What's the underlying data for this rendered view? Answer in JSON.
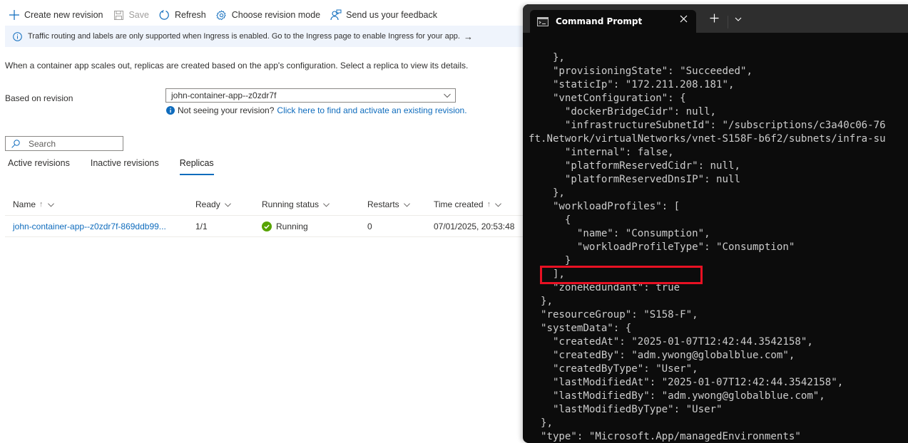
{
  "toolbar": {
    "create": {
      "label": "Create new revision",
      "icon": "plus-icon"
    },
    "save": {
      "label": "Save",
      "icon": "save-icon",
      "disabled": true
    },
    "refresh": {
      "label": "Refresh",
      "icon": "refresh-icon"
    },
    "mode": {
      "label": "Choose revision mode",
      "icon": "gear-icon"
    },
    "feedback": {
      "label": "Send us your feedback",
      "icon": "feedback-icon"
    }
  },
  "info_banner": {
    "text": "Traffic routing and labels are only supported when Ingress is enabled. Go to the Ingress page to enable Ingress for your app.",
    "arrow": "→"
  },
  "description": "When a container app scales out, replicas are created based on the app's configuration. Select a replica to view its details.",
  "revision": {
    "label": "Based on revision",
    "selected": "john-container-app--z0zdr7f",
    "hint_text": "Not seeing your revision?",
    "hint_link": "Click here to find and activate an existing revision."
  },
  "search": {
    "placeholder": "Search"
  },
  "tabs": [
    {
      "label": "Active revisions",
      "active": false
    },
    {
      "label": "Inactive revisions",
      "active": false
    },
    {
      "label": "Replicas",
      "active": true
    }
  ],
  "table": {
    "columns": [
      {
        "label": "Name",
        "sort": "↑"
      },
      {
        "label": "Ready",
        "sort": ""
      },
      {
        "label": "Running status",
        "sort": ""
      },
      {
        "label": "Restarts",
        "sort": ""
      },
      {
        "label": "Time created",
        "sort": "↑"
      }
    ],
    "rows": [
      {
        "name": "john-container-app--z0zdr7f-869ddb99...",
        "ready": "1/1",
        "status": "Running",
        "restarts": "0",
        "time_created": "07/01/2025, 20:53:48"
      }
    ]
  },
  "terminal": {
    "tab_title": "Command Prompt",
    "lines": [
      "    },",
      "    \"provisioningState\": \"Succeeded\",",
      "    \"staticIp\": \"172.211.208.181\",",
      "    \"vnetConfiguration\": {",
      "      \"dockerBridgeCidr\": null,",
      "      \"infrastructureSubnetId\": \"/subscriptions/c3a40c06-76",
      "ft.Network/virtualNetworks/vnet-S158F-b6f2/subnets/infra-su",
      "      \"internal\": false,",
      "      \"platformReservedCidr\": null,",
      "      \"platformReservedDnsIP\": null",
      "    },",
      "    \"workloadProfiles\": [",
      "      {",
      "        \"name\": \"Consumption\",",
      "        \"workloadProfileType\": \"Consumption\"",
      "      }",
      "    ],",
      "    \"zoneRedundant\": true",
      "  },",
      "  \"resourceGroup\": \"S158-F\",",
      "  \"systemData\": {",
      "    \"createdAt\": \"2025-01-07T12:42:44.3542158\",",
      "    \"createdBy\": \"adm.ywong@globalblue.com\",",
      "    \"createdByType\": \"User\",",
      "    \"lastModifiedAt\": \"2025-01-07T12:42:44.3542158\",",
      "    \"lastModifiedBy\": \"adm.ywong@globalblue.com\",",
      "    \"lastModifiedByType\": \"User\"",
      "  },",
      "  \"type\": \"Microsoft.App/managedEnvironments\""
    ],
    "highlighted_line": "\"zoneRedundant\": true"
  },
  "colors": {
    "accent": "#0f6cbd",
    "success": "#57a300",
    "info_bg": "#eff4fc",
    "terminal_bg": "#0c0c0c",
    "highlight": "#e81123"
  }
}
